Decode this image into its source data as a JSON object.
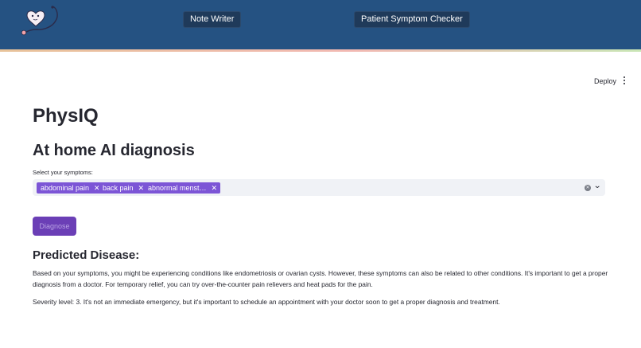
{
  "header": {
    "nav": [
      "Note Writer",
      "Patient Symptom Checker"
    ]
  },
  "toolbar": {
    "deploy_label": "Deploy"
  },
  "page": {
    "title": "PhysIQ",
    "subtitle": "At home AI diagnosis"
  },
  "symptoms": {
    "label": "Select your symptoms:",
    "selected": [
      "abdominal pain",
      "back pain",
      "abnormal menst…"
    ]
  },
  "diagnose_label": "Diagnose",
  "result": {
    "heading": "Predicted Disease:",
    "paragraph1": "Based on your symptoms, you might be experiencing conditions like endometriosis or ovarian cysts. However, these symptoms can also be related to other conditions. It's important to get a proper diagnosis from a doctor. For temporary relief, you can try over-the-counter pain relievers and heat pads for the pain.",
    "paragraph2": "Severity level: 3. It's not an immediate emergency, but it's important to schedule an appointment with your doctor soon to get a proper diagnosis and treatment."
  },
  "colors": {
    "header_bg": "#255282",
    "tag_bg": "#7c55d6",
    "button_bg": "#6b3fb6"
  },
  "icons": [
    "heart-stethoscope-logo-icon",
    "close-icon",
    "clear-icon",
    "chevron-down-icon",
    "kebab-menu-icon"
  ]
}
